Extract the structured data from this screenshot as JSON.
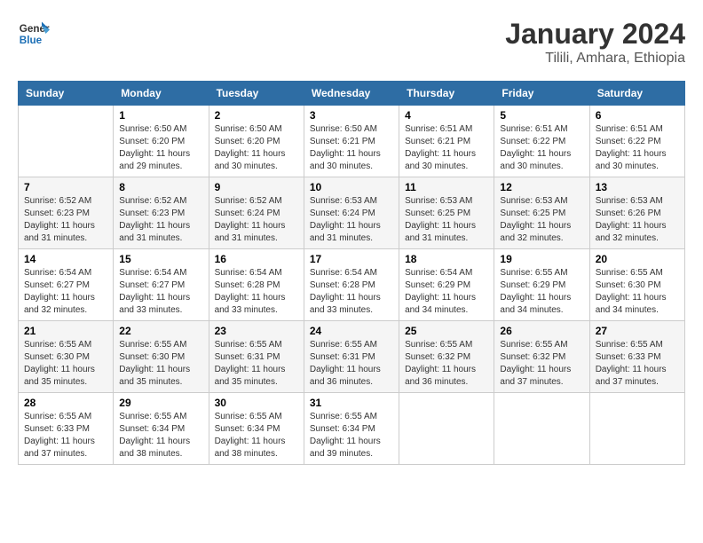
{
  "logo": {
    "line1": "General",
    "line2": "Blue"
  },
  "title": "January 2024",
  "subtitle": "Tilili, Amhara, Ethiopia",
  "days_of_week": [
    "Sunday",
    "Monday",
    "Tuesday",
    "Wednesday",
    "Thursday",
    "Friday",
    "Saturday"
  ],
  "weeks": [
    [
      {
        "day": "",
        "sunrise": "",
        "sunset": "",
        "daylight": ""
      },
      {
        "day": "1",
        "sunrise": "Sunrise: 6:50 AM",
        "sunset": "Sunset: 6:20 PM",
        "daylight": "Daylight: 11 hours and 29 minutes."
      },
      {
        "day": "2",
        "sunrise": "Sunrise: 6:50 AM",
        "sunset": "Sunset: 6:20 PM",
        "daylight": "Daylight: 11 hours and 30 minutes."
      },
      {
        "day": "3",
        "sunrise": "Sunrise: 6:50 AM",
        "sunset": "Sunset: 6:21 PM",
        "daylight": "Daylight: 11 hours and 30 minutes."
      },
      {
        "day": "4",
        "sunrise": "Sunrise: 6:51 AM",
        "sunset": "Sunset: 6:21 PM",
        "daylight": "Daylight: 11 hours and 30 minutes."
      },
      {
        "day": "5",
        "sunrise": "Sunrise: 6:51 AM",
        "sunset": "Sunset: 6:22 PM",
        "daylight": "Daylight: 11 hours and 30 minutes."
      },
      {
        "day": "6",
        "sunrise": "Sunrise: 6:51 AM",
        "sunset": "Sunset: 6:22 PM",
        "daylight": "Daylight: 11 hours and 30 minutes."
      }
    ],
    [
      {
        "day": "7",
        "sunrise": "Sunrise: 6:52 AM",
        "sunset": "Sunset: 6:23 PM",
        "daylight": "Daylight: 11 hours and 31 minutes."
      },
      {
        "day": "8",
        "sunrise": "Sunrise: 6:52 AM",
        "sunset": "Sunset: 6:23 PM",
        "daylight": "Daylight: 11 hours and 31 minutes."
      },
      {
        "day": "9",
        "sunrise": "Sunrise: 6:52 AM",
        "sunset": "Sunset: 6:24 PM",
        "daylight": "Daylight: 11 hours and 31 minutes."
      },
      {
        "day": "10",
        "sunrise": "Sunrise: 6:53 AM",
        "sunset": "Sunset: 6:24 PM",
        "daylight": "Daylight: 11 hours and 31 minutes."
      },
      {
        "day": "11",
        "sunrise": "Sunrise: 6:53 AM",
        "sunset": "Sunset: 6:25 PM",
        "daylight": "Daylight: 11 hours and 31 minutes."
      },
      {
        "day": "12",
        "sunrise": "Sunrise: 6:53 AM",
        "sunset": "Sunset: 6:25 PM",
        "daylight": "Daylight: 11 hours and 32 minutes."
      },
      {
        "day": "13",
        "sunrise": "Sunrise: 6:53 AM",
        "sunset": "Sunset: 6:26 PM",
        "daylight": "Daylight: 11 hours and 32 minutes."
      }
    ],
    [
      {
        "day": "14",
        "sunrise": "Sunrise: 6:54 AM",
        "sunset": "Sunset: 6:27 PM",
        "daylight": "Daylight: 11 hours and 32 minutes."
      },
      {
        "day": "15",
        "sunrise": "Sunrise: 6:54 AM",
        "sunset": "Sunset: 6:27 PM",
        "daylight": "Daylight: 11 hours and 33 minutes."
      },
      {
        "day": "16",
        "sunrise": "Sunrise: 6:54 AM",
        "sunset": "Sunset: 6:28 PM",
        "daylight": "Daylight: 11 hours and 33 minutes."
      },
      {
        "day": "17",
        "sunrise": "Sunrise: 6:54 AM",
        "sunset": "Sunset: 6:28 PM",
        "daylight": "Daylight: 11 hours and 33 minutes."
      },
      {
        "day": "18",
        "sunrise": "Sunrise: 6:54 AM",
        "sunset": "Sunset: 6:29 PM",
        "daylight": "Daylight: 11 hours and 34 minutes."
      },
      {
        "day": "19",
        "sunrise": "Sunrise: 6:55 AM",
        "sunset": "Sunset: 6:29 PM",
        "daylight": "Daylight: 11 hours and 34 minutes."
      },
      {
        "day": "20",
        "sunrise": "Sunrise: 6:55 AM",
        "sunset": "Sunset: 6:30 PM",
        "daylight": "Daylight: 11 hours and 34 minutes."
      }
    ],
    [
      {
        "day": "21",
        "sunrise": "Sunrise: 6:55 AM",
        "sunset": "Sunset: 6:30 PM",
        "daylight": "Daylight: 11 hours and 35 minutes."
      },
      {
        "day": "22",
        "sunrise": "Sunrise: 6:55 AM",
        "sunset": "Sunset: 6:30 PM",
        "daylight": "Daylight: 11 hours and 35 minutes."
      },
      {
        "day": "23",
        "sunrise": "Sunrise: 6:55 AM",
        "sunset": "Sunset: 6:31 PM",
        "daylight": "Daylight: 11 hours and 35 minutes."
      },
      {
        "day": "24",
        "sunrise": "Sunrise: 6:55 AM",
        "sunset": "Sunset: 6:31 PM",
        "daylight": "Daylight: 11 hours and 36 minutes."
      },
      {
        "day": "25",
        "sunrise": "Sunrise: 6:55 AM",
        "sunset": "Sunset: 6:32 PM",
        "daylight": "Daylight: 11 hours and 36 minutes."
      },
      {
        "day": "26",
        "sunrise": "Sunrise: 6:55 AM",
        "sunset": "Sunset: 6:32 PM",
        "daylight": "Daylight: 11 hours and 37 minutes."
      },
      {
        "day": "27",
        "sunrise": "Sunrise: 6:55 AM",
        "sunset": "Sunset: 6:33 PM",
        "daylight": "Daylight: 11 hours and 37 minutes."
      }
    ],
    [
      {
        "day": "28",
        "sunrise": "Sunrise: 6:55 AM",
        "sunset": "Sunset: 6:33 PM",
        "daylight": "Daylight: 11 hours and 37 minutes."
      },
      {
        "day": "29",
        "sunrise": "Sunrise: 6:55 AM",
        "sunset": "Sunset: 6:34 PM",
        "daylight": "Daylight: 11 hours and 38 minutes."
      },
      {
        "day": "30",
        "sunrise": "Sunrise: 6:55 AM",
        "sunset": "Sunset: 6:34 PM",
        "daylight": "Daylight: 11 hours and 38 minutes."
      },
      {
        "day": "31",
        "sunrise": "Sunrise: 6:55 AM",
        "sunset": "Sunset: 6:34 PM",
        "daylight": "Daylight: 11 hours and 39 minutes."
      },
      {
        "day": "",
        "sunrise": "",
        "sunset": "",
        "daylight": ""
      },
      {
        "day": "",
        "sunrise": "",
        "sunset": "",
        "daylight": ""
      },
      {
        "day": "",
        "sunrise": "",
        "sunset": "",
        "daylight": ""
      }
    ]
  ]
}
